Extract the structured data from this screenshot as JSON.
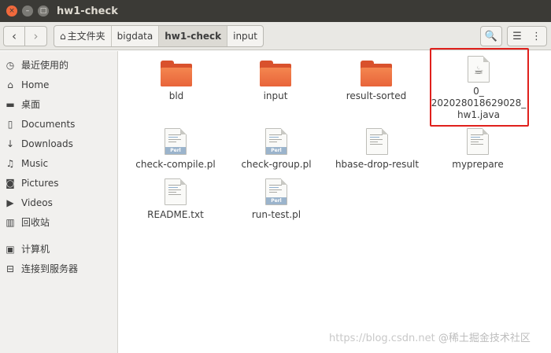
{
  "window": {
    "title": "hw1-check",
    "close_glyph": "×",
    "min_glyph": "–",
    "max_glyph": "□"
  },
  "toolbar": {
    "back_glyph": "‹",
    "forward_glyph": "›",
    "breadcrumb": [
      {
        "label": "主文件夹",
        "icon": "home-icon"
      },
      {
        "label": "bigdata"
      },
      {
        "label": "hw1-check",
        "active": true
      },
      {
        "label": "input"
      }
    ],
    "search_glyph": "🔍",
    "list_glyph": "☰",
    "menu_glyph": "⋮"
  },
  "sidebar": {
    "items": [
      {
        "label": "最近使用的",
        "icon": "clock-icon"
      },
      {
        "label": "Home",
        "icon": "home-icon"
      },
      {
        "label": "桌面",
        "icon": "folder-icon"
      },
      {
        "label": "Documents",
        "icon": "document-icon"
      },
      {
        "label": "Downloads",
        "icon": "download-icon"
      },
      {
        "label": "Music",
        "icon": "music-icon"
      },
      {
        "label": "Pictures",
        "icon": "camera-icon"
      },
      {
        "label": "Videos",
        "icon": "film-icon"
      },
      {
        "label": "回收站",
        "icon": "trash-icon"
      },
      {
        "label": "计算机",
        "icon": "computer-icon"
      },
      {
        "label": "连接到服务器",
        "icon": "server-icon"
      }
    ]
  },
  "files": [
    {
      "name": "bld",
      "type": "folder"
    },
    {
      "name": "input",
      "type": "folder"
    },
    {
      "name": "result-sorted",
      "type": "folder"
    },
    {
      "name_lines": [
        "0_",
        "202028018629028_",
        "hw1.java"
      ],
      "type": "java"
    },
    {
      "name": "check-compile.pl",
      "type": "perl",
      "badge": "Perl"
    },
    {
      "name": "check-group.pl",
      "type": "perl",
      "badge": "Perl"
    },
    {
      "name": "hbase-drop-result",
      "type": "text"
    },
    {
      "name": "myprepare",
      "type": "text"
    },
    {
      "name": "README.txt",
      "type": "text"
    },
    {
      "name": "run-test.pl",
      "type": "perl",
      "badge": "Perl"
    }
  ],
  "colors": {
    "titlebar": "#3b3a36",
    "folder": "#e8643a",
    "highlight": "#e0201c"
  },
  "watermark": {
    "url": "https://blog.csdn.net",
    "brand": "@稀土掘金技术社区"
  }
}
